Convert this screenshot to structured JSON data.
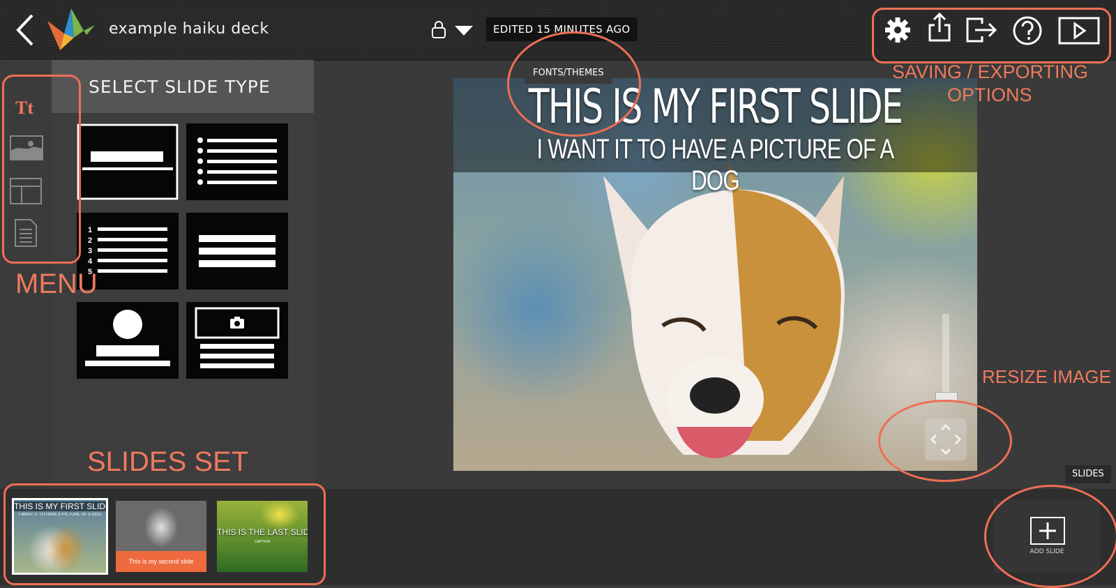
{
  "topbar": {
    "deck_title": "example haiku deck",
    "edited_status": "EDITED 15 MINUTES AGO",
    "icons": [
      "back-arrow-icon",
      "bird-logo-icon",
      "lock-icon",
      "dropdown-icon",
      "gear-icon",
      "share-icon",
      "export-icon",
      "help-icon",
      "play-icon"
    ]
  },
  "left_menu": {
    "items": [
      "Tt",
      "image-icon",
      "layout-icon",
      "notes-icon"
    ]
  },
  "panel": {
    "title": "SELECT SLIDE TYPE",
    "tiles": [
      "title-tile",
      "bullet-list-tile",
      "numbered-list-tile",
      "lines-tile",
      "profile-tile",
      "photo-caption-tile"
    ],
    "numbered_digits": [
      "1",
      "2",
      "3",
      "4",
      "5"
    ]
  },
  "tooltip": {
    "fonts_themes": "FONTS/THEMES"
  },
  "slide": {
    "heading": "THIS IS MY FIRST SLIDE",
    "subheading": "I WANT IT TO HAVE A PICTURE OF A DOG"
  },
  "slides_bar": {
    "tag": "SLIDES",
    "thumbnails": [
      {
        "heading": "THIS IS MY FIRST SLIDE",
        "sub": "I WANT IT TO HAVE A PICTURE OF A DOG"
      },
      {
        "caption": "This is my second slide"
      },
      {
        "heading": "THIS IS THE LAST SLIDE",
        "sub": "CAPTION"
      }
    ],
    "add_label": "ADD SLIDE"
  },
  "annotations": {
    "saving": "SAVING / EXPORTING",
    "options": "OPTIONS",
    "menu": "MENU",
    "resize": "RESIZE IMAGE",
    "slides_set": "SLIDES SET",
    "color": "#ee6f55"
  }
}
